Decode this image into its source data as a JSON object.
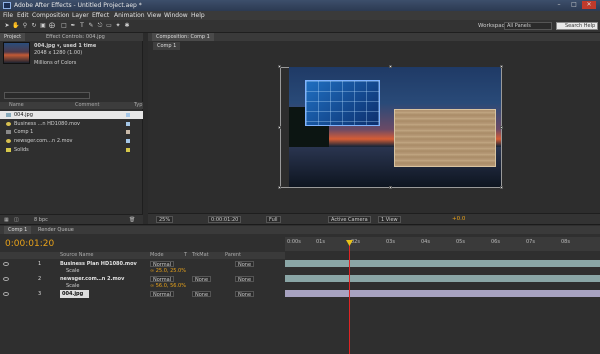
{
  "app": {
    "title": "Adobe After Effects - Untitled Project.aep *"
  },
  "menu": [
    "File",
    "Edit",
    "Composition",
    "Layer",
    "Effect",
    "Animation",
    "View",
    "Window",
    "Help"
  ],
  "toolbar": {
    "workspace_label": "Workspace:",
    "workspace_value": "All Panels",
    "search_help": "Search Help"
  },
  "project": {
    "tabs": [
      "Project",
      "Effect Controls: 004.jpg"
    ],
    "selected_info": [
      "004.jpg ▾, used 1 time",
      "2048 x 1280 (1.00)",
      "",
      "Millions of Colors"
    ],
    "columns": {
      "name": "Name",
      "comment": "Comment",
      "type": "Typ"
    },
    "items": [
      {
        "name": "004.jpg",
        "color": "#a5c7e8",
        "icon": "image-icon"
      },
      {
        "name": "Business ...n HD1080.mov",
        "color": "#a5c7e8",
        "icon": "movie-icon"
      },
      {
        "name": "Comp 1",
        "color": "#c8b9a8",
        "icon": "comp-icon"
      },
      {
        "name": "newsger.com…n 2.mov",
        "color": "#a5c7e8",
        "icon": "movie-icon"
      },
      {
        "name": "Solids",
        "color": "#d6c84a",
        "icon": "folder-icon"
      }
    ],
    "bpc": "8 bpc"
  },
  "composition": {
    "tab": "Composition: Comp 1",
    "subtab": "Comp 1",
    "zoom": "25%",
    "timecode": "0:00:01:20",
    "resolution": "Full",
    "camera": "Active Camera",
    "views": "1 View",
    "exposure": "+0.0"
  },
  "timeline": {
    "tabs": [
      "Comp 1",
      "Render Queue"
    ],
    "timecode": "0:00:01:20",
    "headers": {
      "source": "Source Name",
      "mode": "Mode",
      "t": "T",
      "trkmat": "TrkMat",
      "parent": "Parent"
    },
    "ruler": [
      "0:00s",
      "01s",
      "02s",
      "03s",
      "04s",
      "05s",
      "06s",
      "07s",
      "08s"
    ],
    "layers": [
      {
        "num": "1",
        "name": "Business Plan HD1080.mov",
        "mode": "Normal",
        "trkmat": "",
        "parent": "None",
        "sub": "Scale",
        "subval": "∞ 25.0, 25.0%",
        "bar": "#8aa6a6"
      },
      {
        "num": "2",
        "name": "newsger.com…n 2.mov",
        "mode": "Normal",
        "trkmat": "None",
        "parent": "None",
        "sub": "Scale",
        "subval": "∞ 56.0, 56.0%",
        "bar": "#8aa6a6"
      },
      {
        "num": "3",
        "name": "004.jpg",
        "mode": "Normal",
        "trkmat": "None",
        "parent": "None",
        "sub": "",
        "subval": "",
        "bar": "#a7a2c0"
      }
    ]
  }
}
